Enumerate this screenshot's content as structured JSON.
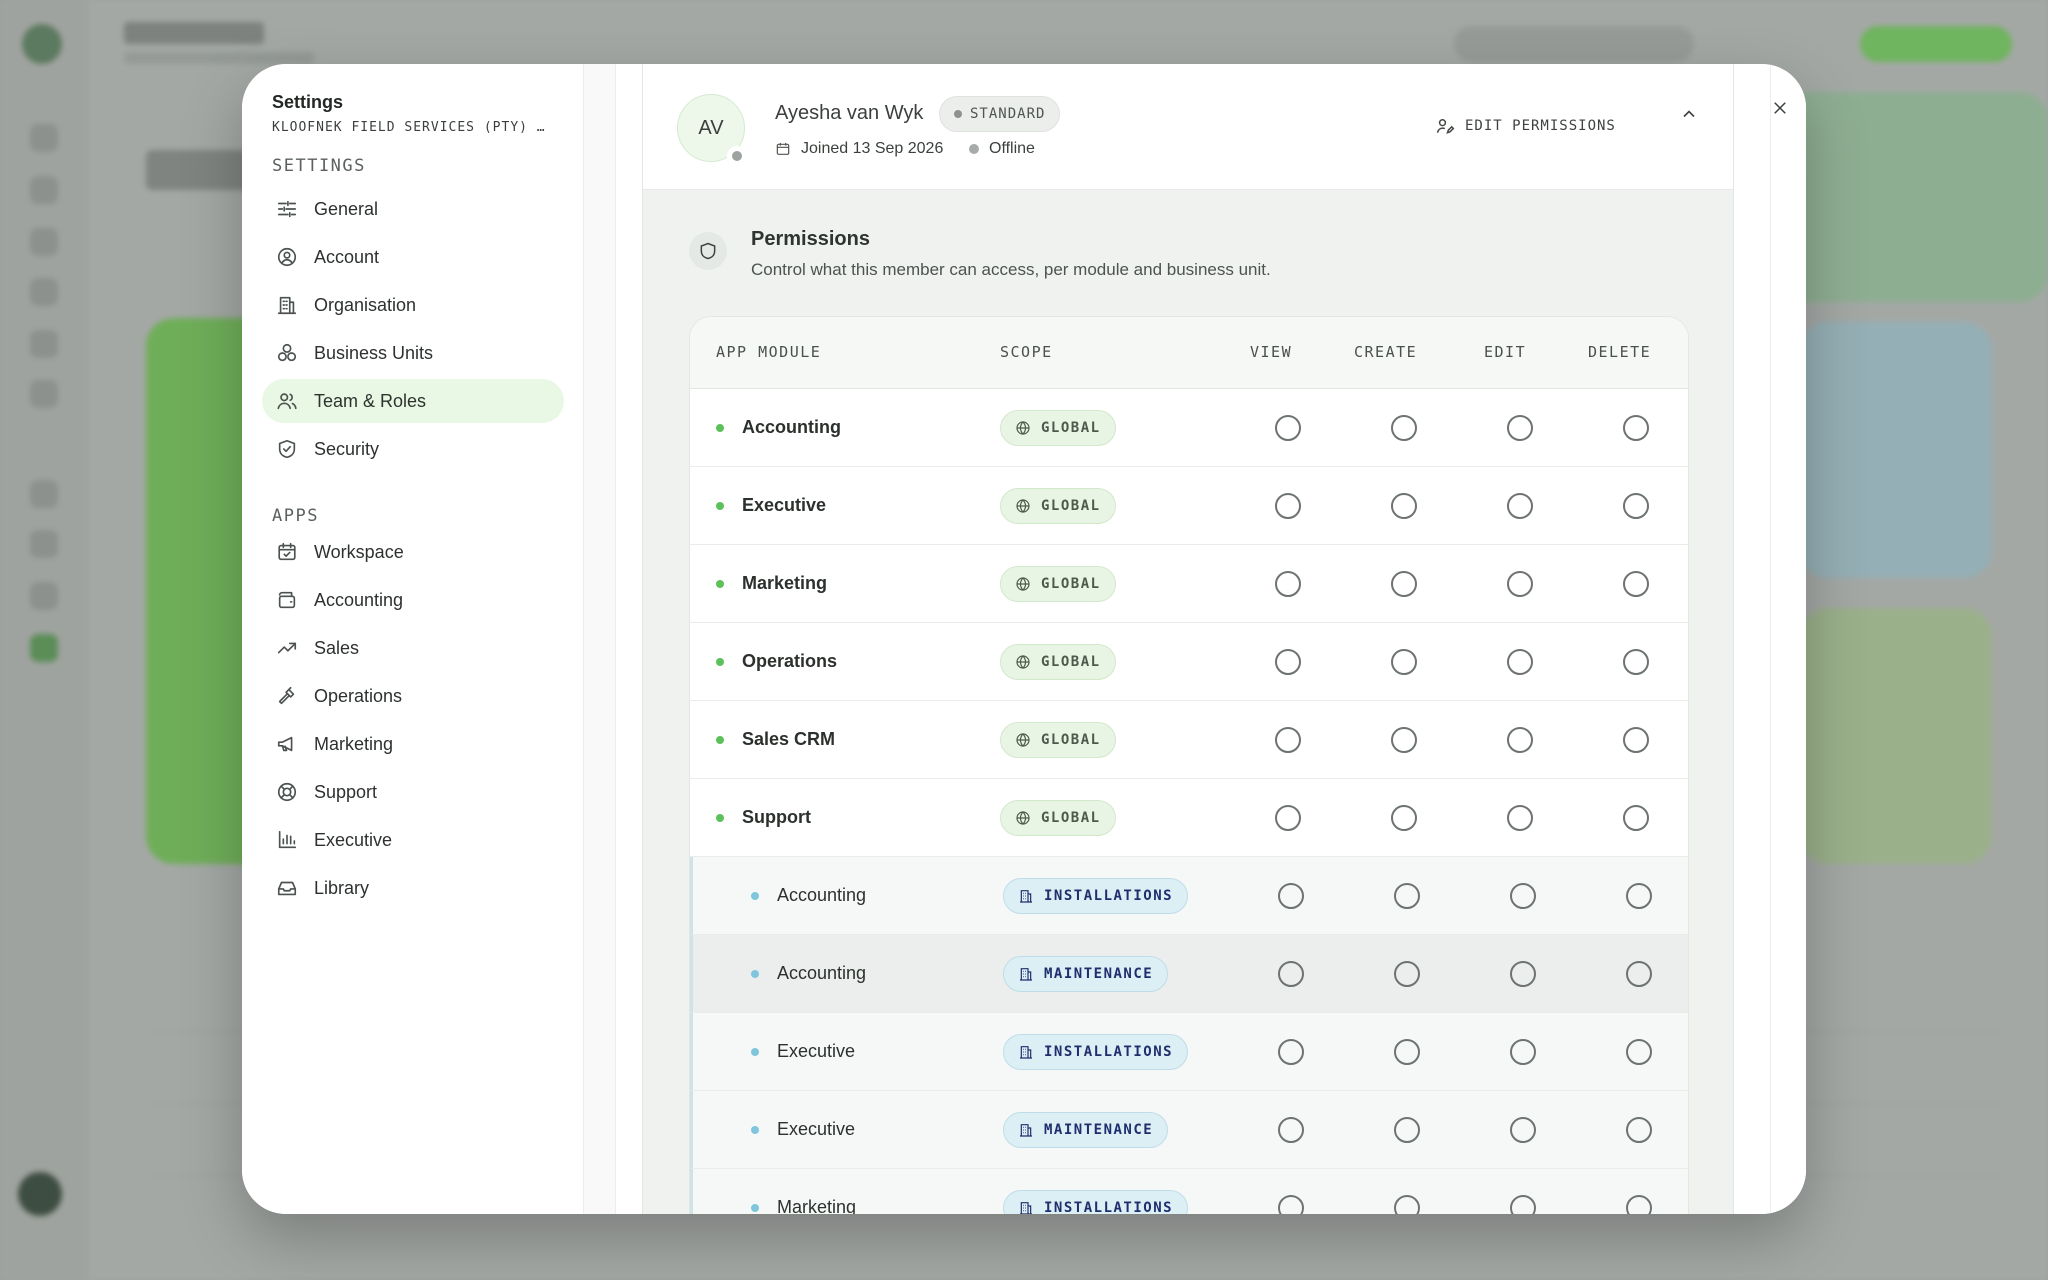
{
  "sidebar": {
    "title": "Settings",
    "org": "KLOOFNEK FIELD SERVICES (PTY) …",
    "sections": {
      "settings": "SETTINGS",
      "apps": "APPS"
    },
    "settings_items": [
      {
        "label": "General",
        "icon": "sliders-icon"
      },
      {
        "label": "Account",
        "icon": "user-circle-icon"
      },
      {
        "label": "Organisation",
        "icon": "building-icon"
      },
      {
        "label": "Business Units",
        "icon": "circles-icon"
      },
      {
        "label": "Team & Roles",
        "icon": "users-icon",
        "active": true
      },
      {
        "label": "Security",
        "icon": "shield-check-icon"
      }
    ],
    "app_items": [
      {
        "label": "Workspace",
        "icon": "calendar-check-icon"
      },
      {
        "label": "Accounting",
        "icon": "wallet-icon"
      },
      {
        "label": "Sales",
        "icon": "trending-up-icon"
      },
      {
        "label": "Operations",
        "icon": "hammer-icon"
      },
      {
        "label": "Marketing",
        "icon": "megaphone-icon"
      },
      {
        "label": "Support",
        "icon": "lifebuoy-icon"
      },
      {
        "label": "Executive",
        "icon": "bar-chart-icon"
      },
      {
        "label": "Library",
        "icon": "inbox-icon"
      }
    ]
  },
  "member": {
    "initials": "AV",
    "name": "Ayesha van Wyk",
    "role_badge": "STANDARD",
    "joined": "Joined 13 Sep 2026",
    "status": "Offline",
    "edit_label": "EDIT PERMISSIONS"
  },
  "permissions": {
    "title": "Permissions",
    "subtitle": "Control what this member can access, per module and business unit.",
    "columns": [
      "APP MODULE",
      "SCOPE",
      "VIEW",
      "CREATE",
      "EDIT",
      "DELETE"
    ],
    "rows": [
      {
        "module": "Accounting",
        "scope": "GLOBAL",
        "kind": "global"
      },
      {
        "module": "Executive",
        "scope": "GLOBAL",
        "kind": "global"
      },
      {
        "module": "Marketing",
        "scope": "GLOBAL",
        "kind": "global"
      },
      {
        "module": "Operations",
        "scope": "GLOBAL",
        "kind": "global"
      },
      {
        "module": "Sales CRM",
        "scope": "GLOBAL",
        "kind": "global"
      },
      {
        "module": "Support",
        "scope": "GLOBAL",
        "kind": "global"
      },
      {
        "module": "Accounting",
        "scope": "INSTALLATIONS",
        "kind": "unit"
      },
      {
        "module": "Accounting",
        "scope": "MAINTENANCE",
        "kind": "unit",
        "hover": true
      },
      {
        "module": "Executive",
        "scope": "INSTALLATIONS",
        "kind": "unit"
      },
      {
        "module": "Executive",
        "scope": "MAINTENANCE",
        "kind": "unit"
      },
      {
        "module": "Marketing",
        "scope": "INSTALLATIONS",
        "kind": "unit"
      }
    ]
  },
  "colors": {
    "accent": "#5cc15a",
    "active_bg": "#e8f8e4",
    "unit_dot": "#7fc6dc"
  }
}
